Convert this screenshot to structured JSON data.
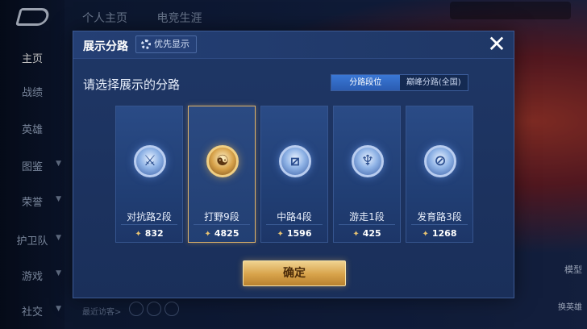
{
  "background": {
    "top_tabs": [
      "个人主页",
      "电竞生涯"
    ],
    "side_nav": [
      {
        "label": "主页",
        "active": true
      },
      {
        "label": "战绩"
      },
      {
        "label": "英雄"
      },
      {
        "label": "图鉴"
      },
      {
        "label": "荣誉"
      },
      {
        "label": "护卫队"
      },
      {
        "label": "游戏"
      },
      {
        "label": "社交"
      }
    ],
    "bottom_hint": "最近访客>",
    "right_label_1": "模型",
    "right_label_2": "换英雄"
  },
  "modal": {
    "title": "展示分路",
    "priority_button": "优先显示",
    "prompt": "请选择展示的分路",
    "toggle": {
      "left": "分路段位",
      "right": "巅峰分路(全国)"
    },
    "lanes": [
      {
        "label": "对抗路2段",
        "score": "832",
        "icon": "clash-lane-icon",
        "selected": false
      },
      {
        "label": "打野9段",
        "score": "4825",
        "icon": "jungle-icon",
        "selected": true
      },
      {
        "label": "中路4段",
        "score": "1596",
        "icon": "mid-lane-icon",
        "selected": false
      },
      {
        "label": "游走1段",
        "score": "425",
        "icon": "roam-icon",
        "selected": false
      },
      {
        "label": "发育路3段",
        "score": "1268",
        "icon": "farm-lane-icon",
        "selected": false
      }
    ],
    "confirm_button": "确定",
    "close_symbol": "✕"
  },
  "colors": {
    "accent_gold": "#e0b46a",
    "toggle_active": "#2a5cb2"
  }
}
